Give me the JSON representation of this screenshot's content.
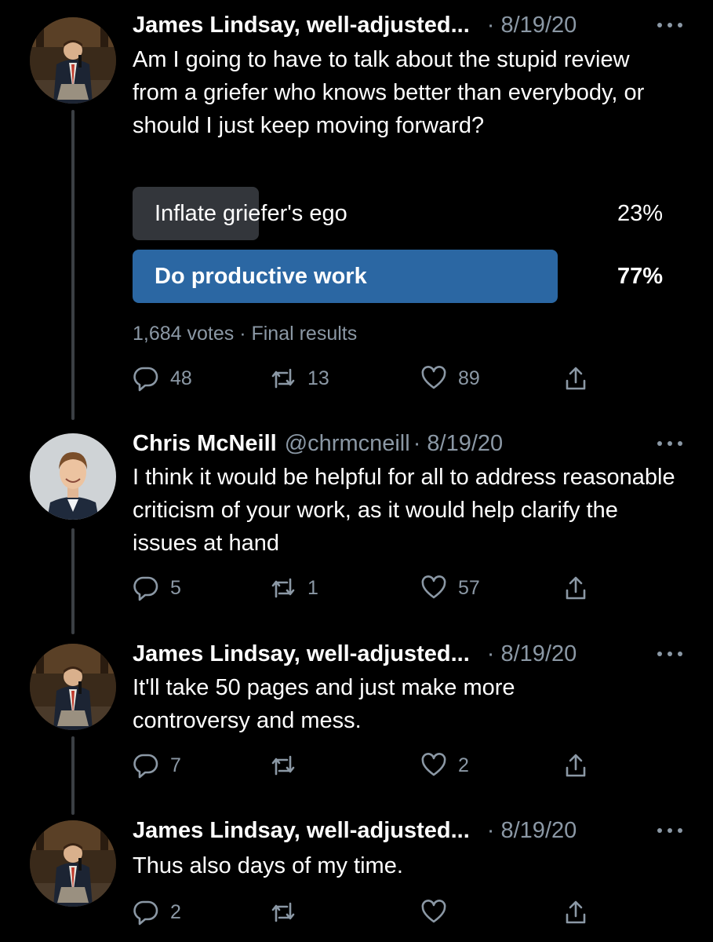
{
  "tweets": [
    {
      "name": "James Lindsay, well-adjusted...",
      "handle": "",
      "date": "· 8/19/20",
      "text": "Am I going to have to talk about the stupid review from a griefer who knows better than everybody, or should I just keep moving forward?",
      "poll": {
        "options": [
          {
            "label": "Inflate griefer's ego",
            "percent": "23%",
            "fraction": 0.23
          },
          {
            "label": "Do productive work",
            "percent": "77%",
            "fraction": 0.77
          }
        ],
        "meta": "1,684 votes · Final results"
      },
      "actions": {
        "replies": "48",
        "retweets": "13",
        "likes": "89"
      },
      "avatar_icon": "man-in-suit-with-microphone"
    },
    {
      "name": "Chris McNeill",
      "handle": "@chrmcneill",
      "date": "· 8/19/20",
      "text": "I think it would be helpful for all to address reasonable criticism of your work, as it would help clarify the issues at hand",
      "actions": {
        "replies": "5",
        "retweets": "1",
        "likes": "57"
      },
      "avatar_icon": "smiling-man-portrait"
    },
    {
      "name": "James Lindsay, well-adjusted...",
      "handle": "",
      "date": "· 8/19/20",
      "text": "It'll take 50 pages and just make more controversy and mess.",
      "actions": {
        "replies": "7",
        "retweets": "",
        "likes": "2"
      },
      "avatar_icon": "man-in-suit-with-microphone"
    },
    {
      "name": "James Lindsay, well-adjusted...",
      "handle": "",
      "date": "· 8/19/20",
      "text": "Thus also days of my time.",
      "actions": {
        "replies": "2",
        "retweets": "",
        "likes": ""
      },
      "avatar_icon": "man-in-suit-with-microphone"
    }
  ],
  "icons": {
    "reply": "reply-icon",
    "retweet": "retweet-icon",
    "like": "heart-icon",
    "share": "share-icon",
    "more": "more-icon"
  },
  "colors": {
    "background": "#000000",
    "secondary_text": "#8b98a5",
    "poll_winner": "#2b67a3",
    "poll_other": "#33363b",
    "thread_line": "#3b3f44"
  }
}
